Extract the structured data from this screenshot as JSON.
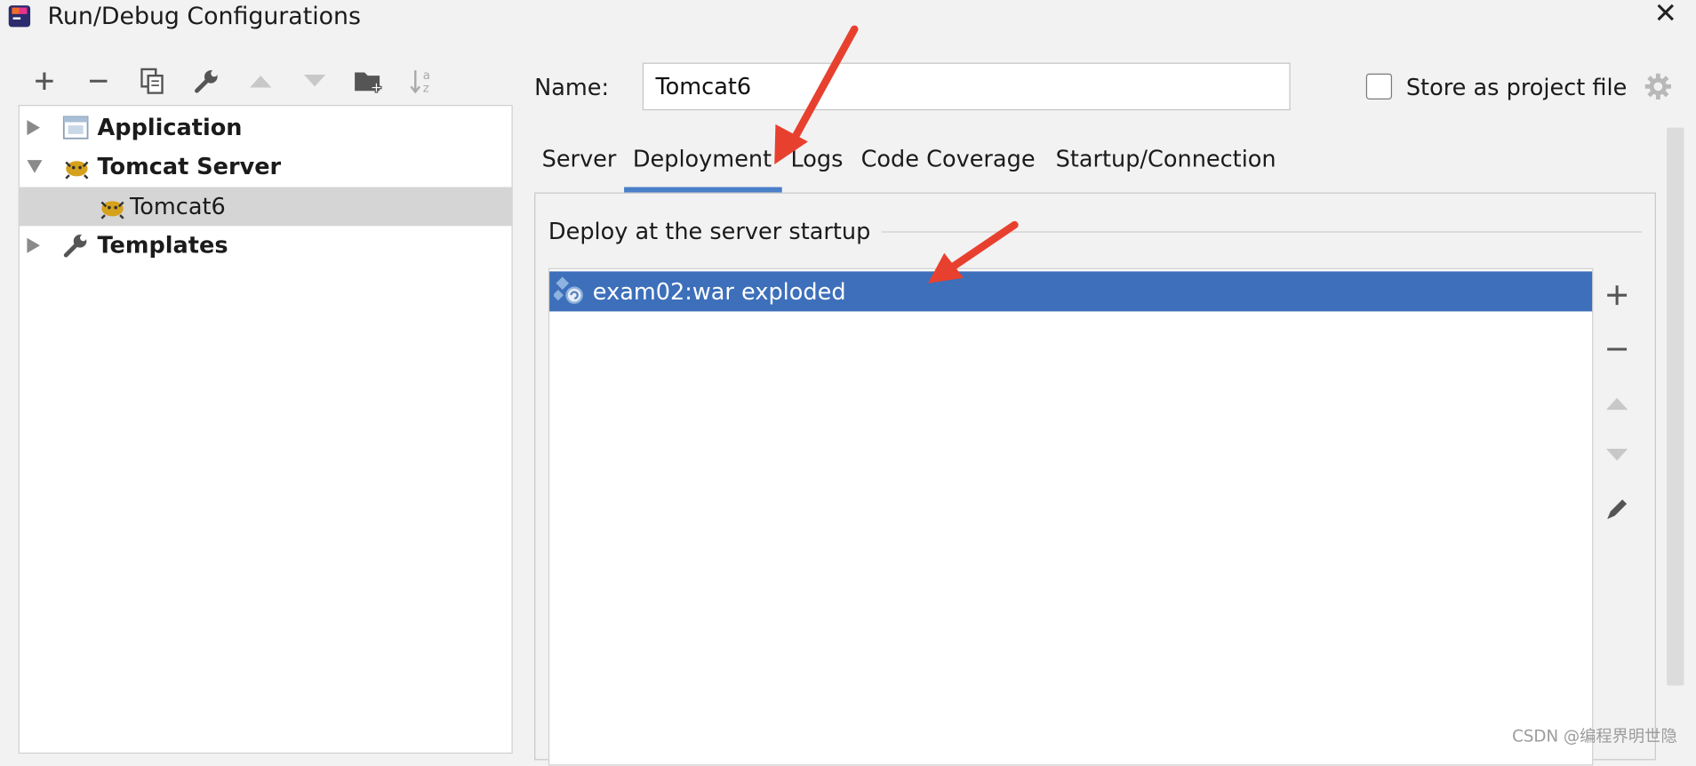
{
  "window": {
    "title": "Run/Debug Configurations"
  },
  "toolbar": {
    "buttons": [
      "add-icon",
      "remove-icon",
      "copy-icon",
      "wrench-icon",
      "move-up-icon",
      "move-down-icon",
      "new-folder-icon",
      "sort-icon"
    ]
  },
  "tree": {
    "items": [
      {
        "label": "Application",
        "icon": "application-icon",
        "expanded": false
      },
      {
        "label": "Tomcat Server",
        "icon": "tomcat-icon",
        "expanded": true
      },
      {
        "label": "Tomcat6",
        "icon": "tomcat-icon",
        "selected": true
      },
      {
        "label": "Templates",
        "icon": "wrench-icon",
        "expanded": false
      }
    ]
  },
  "form": {
    "name_label": "Name:",
    "name_value": "Tomcat6",
    "store_label": "Store as project file",
    "store_checked": false
  },
  "tabs": [
    {
      "label": "Server"
    },
    {
      "label": "Deployment",
      "active": true
    },
    {
      "label": "Logs"
    },
    {
      "label": "Code Coverage"
    },
    {
      "label": "Startup/Connection"
    }
  ],
  "deployment": {
    "group_label": "Deploy at the server startup",
    "artifacts": [
      {
        "label": "exam02:war exploded",
        "selected": true
      }
    ],
    "side_buttons": [
      "add-icon",
      "remove-icon",
      "move-up-icon",
      "move-down-icon",
      "edit-icon"
    ]
  },
  "watermark": "CSDN @编程界明世隐",
  "colors": {
    "selection": "#3d6fba",
    "tab_underline": "#4a7fc9",
    "annotation_arrow": "#e8402f"
  }
}
